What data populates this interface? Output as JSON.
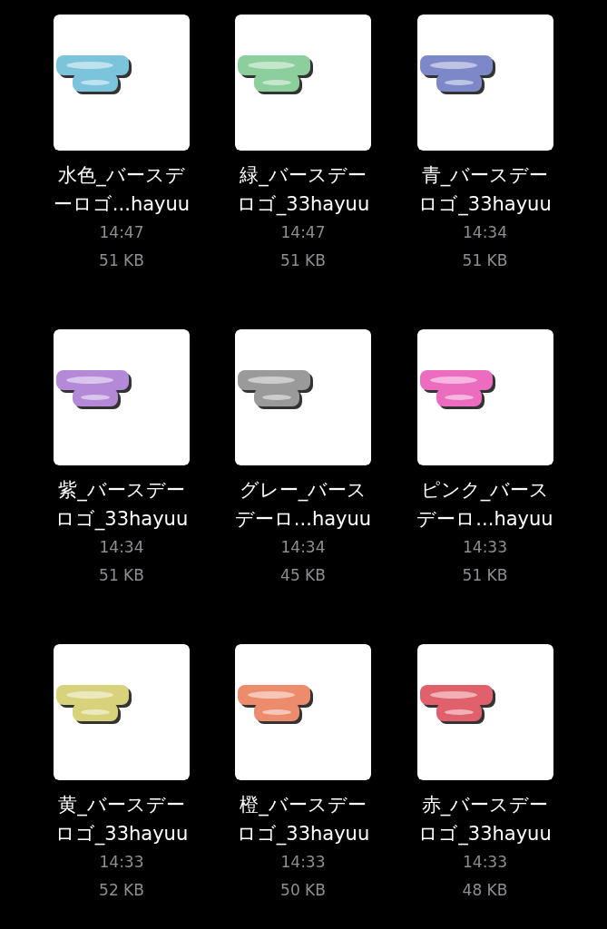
{
  "files": [
    {
      "name": [
        "水色_バースデ",
        "ーロゴ...hayuu"
      ],
      "time": "14:47",
      "size": "51 KB"
    },
    {
      "name": [
        "緑_バースデー",
        "ロゴ_33hayuu"
      ],
      "time": "14:47",
      "size": "51 KB"
    },
    {
      "name": [
        "青_バースデー",
        "ロゴ_33hayuu"
      ],
      "time": "14:34",
      "size": "51 KB"
    },
    {
      "name": [
        "紫_バースデー",
        "ロゴ_33hayuu"
      ],
      "time": "14:34",
      "size": "51 KB"
    },
    {
      "name": [
        "グレー_バース",
        "デーロ...hayuu"
      ],
      "time": "14:34",
      "size": "45 KB"
    },
    {
      "name": [
        "ピンク_バース",
        "デーロ...hayuu"
      ],
      "time": "14:33",
      "size": "51 KB"
    },
    {
      "name": [
        "黄_バースデー",
        "ロゴ_33hayuu"
      ],
      "time": "14:33",
      "size": "52 KB"
    },
    {
      "name": [
        "橙_バースデー",
        "ロゴ_33hayuu"
      ],
      "time": "14:33",
      "size": "50 KB"
    },
    {
      "name": [
        "赤_バースデー",
        "ロゴ_33hayuu"
      ],
      "time": "14:33",
      "size": "48 KB"
    }
  ]
}
